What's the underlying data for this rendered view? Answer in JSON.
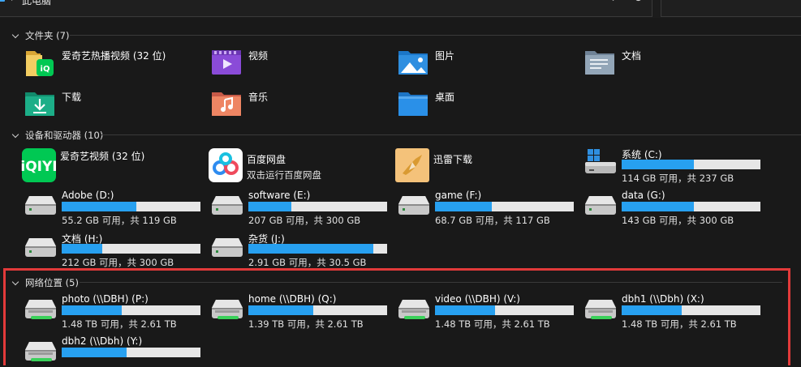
{
  "address": {
    "crumb": "此电脑"
  },
  "sections": {
    "folders": "文件夹 (7)",
    "devices": "设备和驱动器 (10)",
    "network": "网络位置 (5)"
  },
  "folders": [
    {
      "label": "爱奇艺热播视频 (32 位)"
    },
    {
      "label": "视频"
    },
    {
      "label": "图片"
    },
    {
      "label": "文档"
    },
    {
      "label": "下载"
    },
    {
      "label": "音乐"
    },
    {
      "label": "桌面"
    }
  ],
  "apps": [
    {
      "label": "爱奇艺视频 (32 位)",
      "sub": ""
    },
    {
      "label": "百度网盘",
      "sub": "双击运行百度网盘"
    },
    {
      "label": "迅雷下载",
      "sub": ""
    }
  ],
  "drives": [
    {
      "name": "系统 (C:)",
      "free": "114 GB 可用，共 237 GB",
      "used": 0.52
    },
    {
      "name": "Adobe (D:)",
      "free": "55.2 GB 可用，共 119 GB",
      "used": 0.54
    },
    {
      "name": "software (E:)",
      "free": "207 GB 可用，共 300 GB",
      "used": 0.31
    },
    {
      "name": "game (F:)",
      "free": "68.7 GB 可用，共 117 GB",
      "used": 0.41
    },
    {
      "name": "data (G:)",
      "free": "143 GB 可用，共 300 GB",
      "used": 0.52
    },
    {
      "name": "文档 (H:)",
      "free": "212 GB 可用，共 300 GB",
      "used": 0.29
    },
    {
      "name": "杂货 (J:)",
      "free": "2.91 GB 可用，共 30.5 GB",
      "used": 0.9
    }
  ],
  "network": [
    {
      "name": "photo (\\\\DBH) (P:)",
      "free": "1.48 TB 可用，共 2.61 TB",
      "used": 0.43
    },
    {
      "name": "home (\\\\DBH) (Q:)",
      "free": "1.39 TB 可用，共 2.61 TB",
      "used": 0.47
    },
    {
      "name": "video (\\\\DBH) (V:)",
      "free": "1.48 TB 可用，共 2.61 TB",
      "used": 0.43
    },
    {
      "name": "dbh1 (\\\\Dbh) (X:)",
      "free": "1.48 TB 可用，共 2.61 TB",
      "used": 0.43
    },
    {
      "name": "dbh2 (\\\\Dbh) (Y:)",
      "free": "",
      "used": 0.47
    }
  ],
  "colors": {
    "accent": "#27a0f0",
    "bar_track": "#e6e6e6",
    "highlight": "#e23a3a",
    "background": "#191919"
  },
  "icons": {
    "computer": "computer-icon",
    "drive": "hard-drive-icon",
    "network_drive": "network-drive-icon"
  }
}
